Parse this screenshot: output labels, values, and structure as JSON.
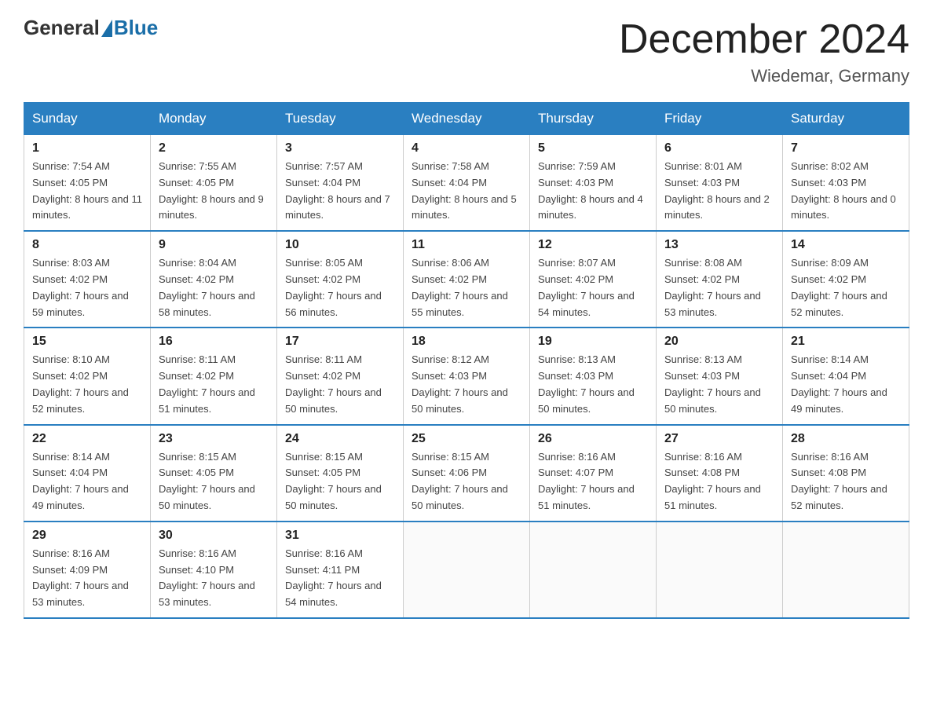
{
  "header": {
    "logo_general": "General",
    "logo_blue": "Blue",
    "month_title": "December 2024",
    "location": "Wiedemar, Germany"
  },
  "days_of_week": [
    "Sunday",
    "Monday",
    "Tuesday",
    "Wednesday",
    "Thursday",
    "Friday",
    "Saturday"
  ],
  "weeks": [
    [
      {
        "day": "1",
        "sunrise": "7:54 AM",
        "sunset": "4:05 PM",
        "daylight": "8 hours and 11 minutes."
      },
      {
        "day": "2",
        "sunrise": "7:55 AM",
        "sunset": "4:05 PM",
        "daylight": "8 hours and 9 minutes."
      },
      {
        "day": "3",
        "sunrise": "7:57 AM",
        "sunset": "4:04 PM",
        "daylight": "8 hours and 7 minutes."
      },
      {
        "day": "4",
        "sunrise": "7:58 AM",
        "sunset": "4:04 PM",
        "daylight": "8 hours and 5 minutes."
      },
      {
        "day": "5",
        "sunrise": "7:59 AM",
        "sunset": "4:03 PM",
        "daylight": "8 hours and 4 minutes."
      },
      {
        "day": "6",
        "sunrise": "8:01 AM",
        "sunset": "4:03 PM",
        "daylight": "8 hours and 2 minutes."
      },
      {
        "day": "7",
        "sunrise": "8:02 AM",
        "sunset": "4:03 PM",
        "daylight": "8 hours and 0 minutes."
      }
    ],
    [
      {
        "day": "8",
        "sunrise": "8:03 AM",
        "sunset": "4:02 PM",
        "daylight": "7 hours and 59 minutes."
      },
      {
        "day": "9",
        "sunrise": "8:04 AM",
        "sunset": "4:02 PM",
        "daylight": "7 hours and 58 minutes."
      },
      {
        "day": "10",
        "sunrise": "8:05 AM",
        "sunset": "4:02 PM",
        "daylight": "7 hours and 56 minutes."
      },
      {
        "day": "11",
        "sunrise": "8:06 AM",
        "sunset": "4:02 PM",
        "daylight": "7 hours and 55 minutes."
      },
      {
        "day": "12",
        "sunrise": "8:07 AM",
        "sunset": "4:02 PM",
        "daylight": "7 hours and 54 minutes."
      },
      {
        "day": "13",
        "sunrise": "8:08 AM",
        "sunset": "4:02 PM",
        "daylight": "7 hours and 53 minutes."
      },
      {
        "day": "14",
        "sunrise": "8:09 AM",
        "sunset": "4:02 PM",
        "daylight": "7 hours and 52 minutes."
      }
    ],
    [
      {
        "day": "15",
        "sunrise": "8:10 AM",
        "sunset": "4:02 PM",
        "daylight": "7 hours and 52 minutes."
      },
      {
        "day": "16",
        "sunrise": "8:11 AM",
        "sunset": "4:02 PM",
        "daylight": "7 hours and 51 minutes."
      },
      {
        "day": "17",
        "sunrise": "8:11 AM",
        "sunset": "4:02 PM",
        "daylight": "7 hours and 50 minutes."
      },
      {
        "day": "18",
        "sunrise": "8:12 AM",
        "sunset": "4:03 PM",
        "daylight": "7 hours and 50 minutes."
      },
      {
        "day": "19",
        "sunrise": "8:13 AM",
        "sunset": "4:03 PM",
        "daylight": "7 hours and 50 minutes."
      },
      {
        "day": "20",
        "sunrise": "8:13 AM",
        "sunset": "4:03 PM",
        "daylight": "7 hours and 50 minutes."
      },
      {
        "day": "21",
        "sunrise": "8:14 AM",
        "sunset": "4:04 PM",
        "daylight": "7 hours and 49 minutes."
      }
    ],
    [
      {
        "day": "22",
        "sunrise": "8:14 AM",
        "sunset": "4:04 PM",
        "daylight": "7 hours and 49 minutes."
      },
      {
        "day": "23",
        "sunrise": "8:15 AM",
        "sunset": "4:05 PM",
        "daylight": "7 hours and 50 minutes."
      },
      {
        "day": "24",
        "sunrise": "8:15 AM",
        "sunset": "4:05 PM",
        "daylight": "7 hours and 50 minutes."
      },
      {
        "day": "25",
        "sunrise": "8:15 AM",
        "sunset": "4:06 PM",
        "daylight": "7 hours and 50 minutes."
      },
      {
        "day": "26",
        "sunrise": "8:16 AM",
        "sunset": "4:07 PM",
        "daylight": "7 hours and 51 minutes."
      },
      {
        "day": "27",
        "sunrise": "8:16 AM",
        "sunset": "4:08 PM",
        "daylight": "7 hours and 51 minutes."
      },
      {
        "day": "28",
        "sunrise": "8:16 AM",
        "sunset": "4:08 PM",
        "daylight": "7 hours and 52 minutes."
      }
    ],
    [
      {
        "day": "29",
        "sunrise": "8:16 AM",
        "sunset": "4:09 PM",
        "daylight": "7 hours and 53 minutes."
      },
      {
        "day": "30",
        "sunrise": "8:16 AM",
        "sunset": "4:10 PM",
        "daylight": "7 hours and 53 minutes."
      },
      {
        "day": "31",
        "sunrise": "8:16 AM",
        "sunset": "4:11 PM",
        "daylight": "7 hours and 54 minutes."
      },
      null,
      null,
      null,
      null
    ]
  ],
  "labels": {
    "sunrise": "Sunrise:",
    "sunset": "Sunset:",
    "daylight": "Daylight:"
  }
}
